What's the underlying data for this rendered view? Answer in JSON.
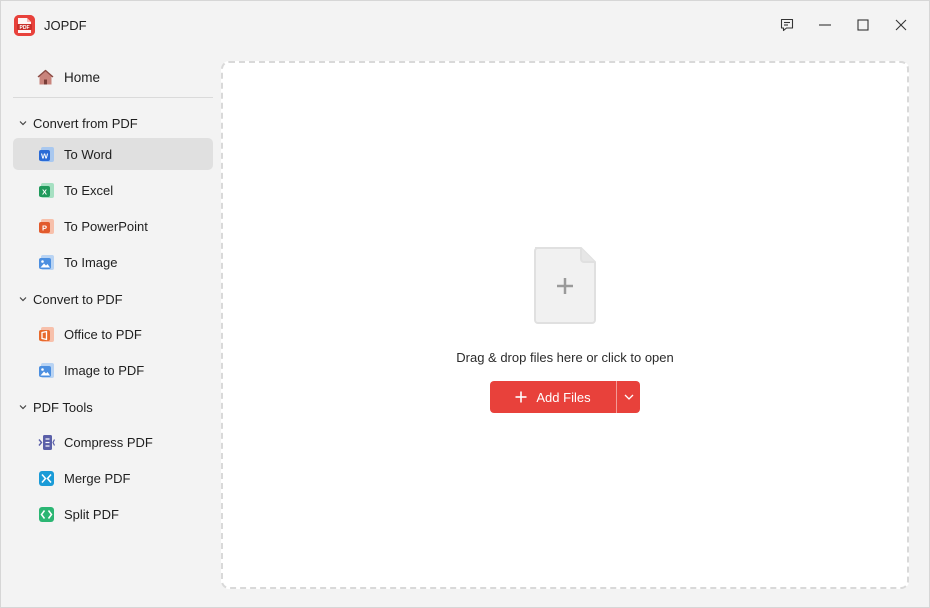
{
  "app": {
    "title": "JOPDF",
    "logo_text": "PDF",
    "brand_color": "#e8413b"
  },
  "window_controls": [
    "feedback-icon",
    "minimize-icon",
    "maximize-icon",
    "close-icon"
  ],
  "sidebar": {
    "home": {
      "label": "Home",
      "icon": "home-icon"
    },
    "sections": [
      {
        "label": "Convert from PDF",
        "items": [
          {
            "label": "To Word",
            "icon": "word-icon",
            "active": true
          },
          {
            "label": "To Excel",
            "icon": "excel-icon"
          },
          {
            "label": "To PowerPoint",
            "icon": "powerpoint-icon"
          },
          {
            "label": "To Image",
            "icon": "image-icon"
          }
        ]
      },
      {
        "label": "Convert to PDF",
        "items": [
          {
            "label": "Office to PDF",
            "icon": "office-icon"
          },
          {
            "label": "Image to PDF",
            "icon": "image-icon"
          }
        ]
      },
      {
        "label": "PDF Tools",
        "items": [
          {
            "label": "Compress PDF",
            "icon": "compress-icon"
          },
          {
            "label": "Merge PDF",
            "icon": "merge-icon"
          },
          {
            "label": "Split PDF",
            "icon": "split-icon"
          }
        ]
      }
    ]
  },
  "main": {
    "drop_hint": "Drag & drop files here or click to open",
    "add_files_label": "Add Files"
  }
}
